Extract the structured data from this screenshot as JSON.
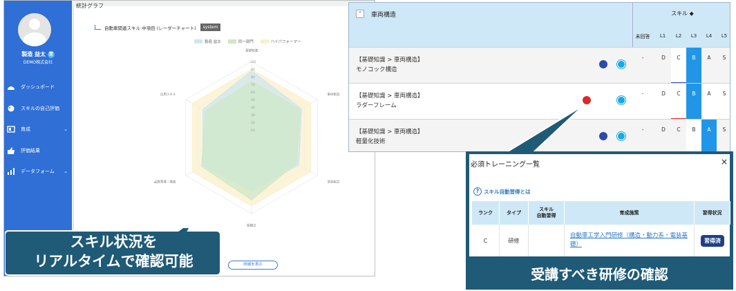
{
  "sidebar": {
    "user_name": "製造 益太",
    "user_badge": "営",
    "company": "DEMO株式会社",
    "items": [
      {
        "label": "ダッシュボード",
        "icon": "dashboard-icon"
      },
      {
        "label": "スキルの自己評価",
        "icon": "palette-icon"
      },
      {
        "label": "育成",
        "icon": "training-icon",
        "chevron": "⌄"
      },
      {
        "label": "評価結果",
        "icon": "thumbs-up-icon"
      },
      {
        "label": "データフォーム",
        "icon": "data-icon",
        "chevron": "⌄"
      }
    ]
  },
  "card": {
    "title": "統計グラフ",
    "chart_title": "自動車関連スキル 中項目 (レーダーチャート)",
    "system_badge": "system",
    "detail_button": "詳細を表示"
  },
  "chart_data": {
    "type": "radar",
    "axes": [
      "基礎知識",
      "車体製造",
      "塗装組立",
      "組織立",
      "品質管理・検査",
      "応用スキル"
    ],
    "rlim": [
      0,
      100
    ],
    "ticks": [
      "10",
      "20",
      "30",
      "40",
      "50",
      "60",
      "70",
      "80",
      "90",
      "100"
    ],
    "series": [
      {
        "name": "製造 益太",
        "values": [
          88,
          76,
          72,
          70,
          74,
          74
        ],
        "color": "#cfe6ee"
      },
      {
        "name": "同一部門",
        "values": [
          74,
          74,
          68,
          82,
          76,
          70
        ],
        "color": "#cfe8c8"
      },
      {
        "name": "ハイパフォーマー",
        "values": [
          90,
          90,
          90,
          90,
          90,
          90
        ],
        "color": "#fbf0cc"
      }
    ]
  },
  "callout_left": {
    "line1": "スキル状況を",
    "line2": "リアルタイムで確認可能"
  },
  "skill_table": {
    "collapse_btn": "^",
    "category": "車両構造",
    "skill_header": "スキル ◆",
    "levels": [
      "未回答",
      "L1",
      "L2",
      "L3",
      "L4",
      "L5"
    ],
    "rows": [
      {
        "path": "【基礎知識 > 車両構造】",
        "name": "モノコック構造",
        "values": [
          "-",
          "D",
          "C",
          "B",
          "A",
          "S"
        ],
        "highlight": 3,
        "flag": "navy"
      },
      {
        "path": "【基礎知識 > 車両構造】",
        "name": "ラダーフレーム",
        "values": [
          "-",
          "D",
          "C",
          "B",
          "A",
          "S"
        ],
        "highlight": 3,
        "flag": "red"
      },
      {
        "path": "【基礎知識 > 車両構造】",
        "name": "軽量化技術",
        "values": [
          "-",
          "D",
          "C",
          "B",
          "A",
          "S"
        ],
        "highlight": 4,
        "flag": "navy"
      }
    ]
  },
  "training_panel": {
    "title": "必須トレーニング一覧",
    "close": "×",
    "help_link": "スキル自動習得とは",
    "help_icon": "?",
    "headers": [
      "ランク",
      "タイプ",
      "スキル\n自動習得",
      "育成施策",
      "習得状況"
    ],
    "row": {
      "rank": "C",
      "type": "研修",
      "auto": "",
      "course": "自動車工学入門研修（構造・動力系・電装基礎）",
      "status": "習得済"
    },
    "caption": "受講すべき研修の確認"
  }
}
